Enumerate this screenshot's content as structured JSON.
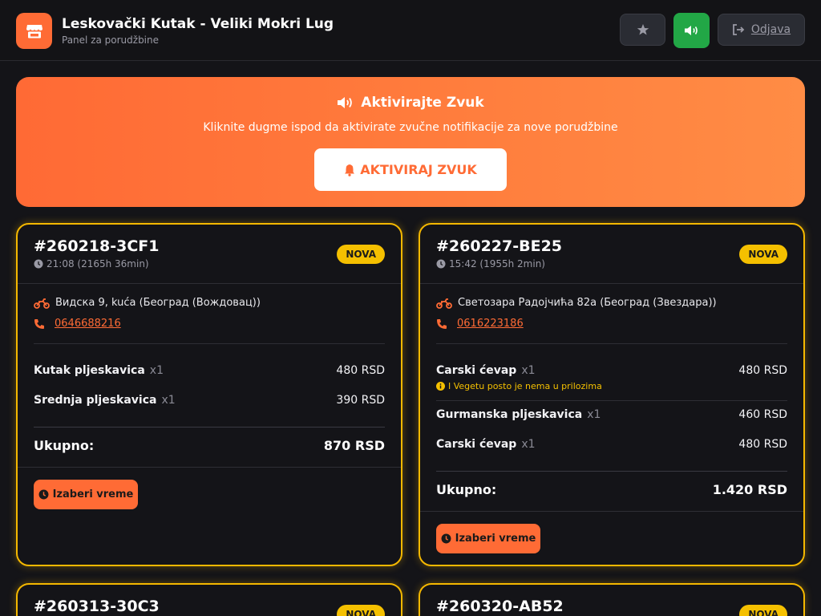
{
  "header": {
    "title": "Leskovački Kutak - Veliki Mokri Lug",
    "subtitle": "Panel za porudžbine",
    "logout_label": "Odjava"
  },
  "banner": {
    "title": "Aktivirajte Zvuk",
    "text": "Kliknite dugme ispod da aktivirate zvučne notifikacije za nove porudžbine",
    "button_label": "AKTIVIRAJ ZVUK"
  },
  "colors": {
    "accent": "#ff6b35",
    "badge": "#f5c000",
    "sound_button": "#22a746",
    "background": "#141418"
  },
  "orders": [
    {
      "id": "#260218-3CF1",
      "time": "21:08 (2165h 36min)",
      "badge": "NOVA",
      "address": "Видска 9, kuća (Београд (Вождовац))",
      "phone": "0646688216",
      "items": [
        {
          "name": "Kutak pljeskavica",
          "qty": "x1",
          "price": "480 RSD",
          "note": ""
        },
        {
          "name": "Srednja pljeskavica",
          "qty": "x1",
          "price": "390 RSD",
          "note": ""
        }
      ],
      "total_label": "Ukupno:",
      "total": "870 RSD",
      "action_label": "Izaberi vreme"
    },
    {
      "id": "#260227-BE25",
      "time": "15:42 (1955h 2min)",
      "badge": "NOVA",
      "address": "Светозара Радојчића 82а (Београд (Звездара))",
      "phone": "0616223186",
      "items": [
        {
          "name": "Carski ćevap",
          "qty": "x1",
          "price": "480 RSD",
          "note": "I Vegetu posto je nema u prilozima"
        },
        {
          "name": "Gurmanska pljeskavica",
          "qty": "x1",
          "price": "460 RSD",
          "note": ""
        },
        {
          "name": "Carski ćevap",
          "qty": "x1",
          "price": "480 RSD",
          "note": ""
        }
      ],
      "total_label": "Ukupno:",
      "total": "1.420 RSD",
      "action_label": "Izaberi vreme"
    },
    {
      "id": "#260313-30C3",
      "badge": "NOVA"
    },
    {
      "id": "#260320-AB52",
      "badge": "NOVA"
    }
  ]
}
